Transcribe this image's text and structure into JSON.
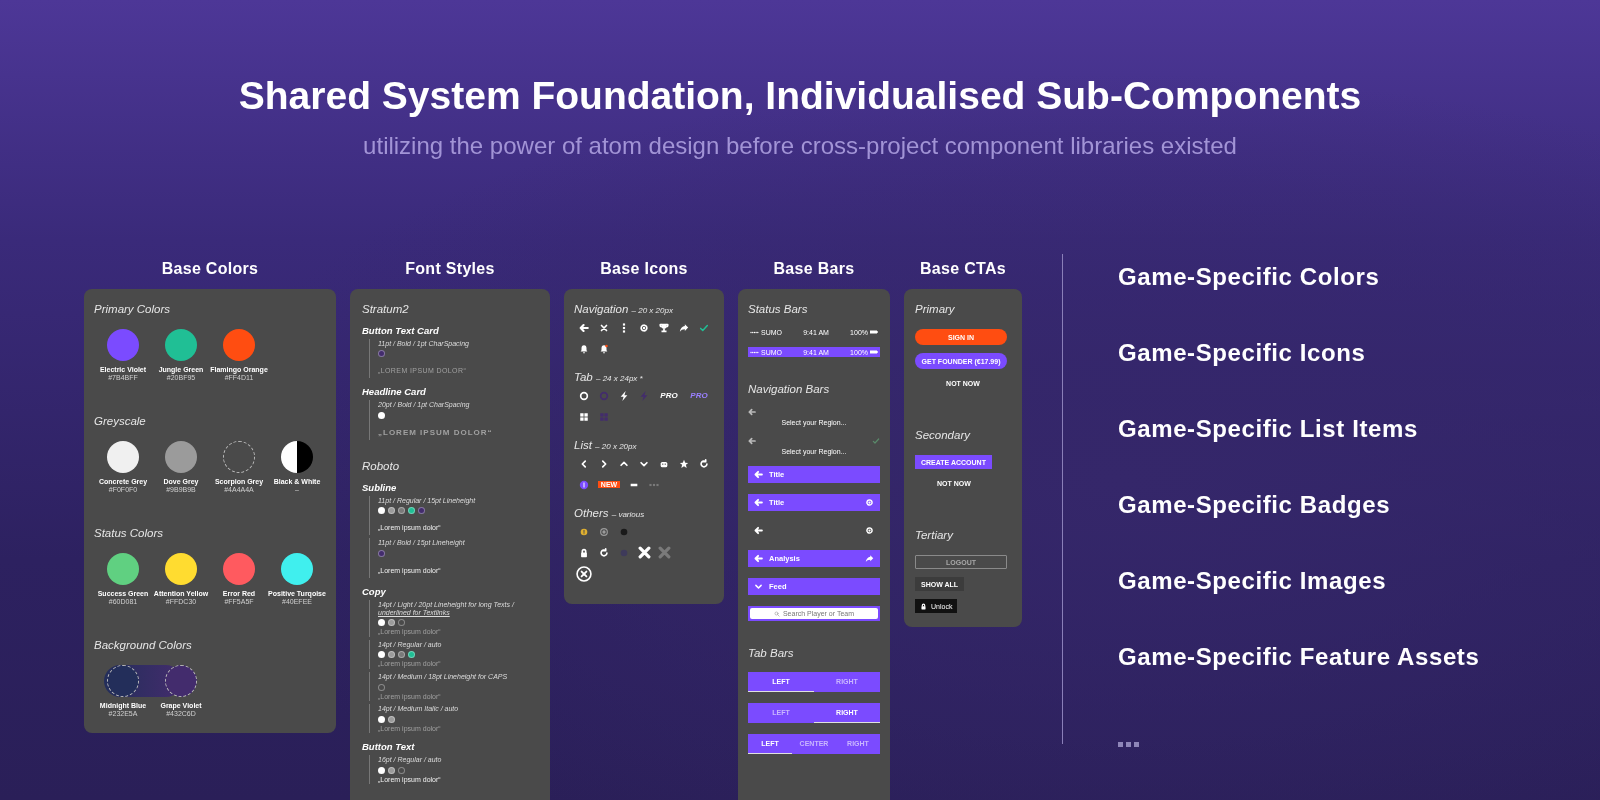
{
  "title": "Shared System Foundation, Individualised Sub-Components",
  "subtitle": "utilizing the power of atom design before cross-project component libraries existed",
  "base_colors": {
    "heading": "Base Colors",
    "groups": [
      {
        "title": "Primary Colors",
        "joined": false,
        "swatches": [
          {
            "name": "Electric Violet",
            "hex": "#7B4BFF",
            "color": "#7b4bff",
            "kind": "solid"
          },
          {
            "name": "Jungle Green",
            "hex": "#20BF95",
            "color": "#20bf95",
            "kind": "solid"
          },
          {
            "name": "Flamingo Orange",
            "hex": "#FF4D11",
            "color": "#ff4d11",
            "kind": "solid"
          }
        ]
      },
      {
        "title": "Greyscale",
        "joined": false,
        "swatches": [
          {
            "name": "Concrete Grey",
            "hex": "#F0F0F0",
            "color": "#f0f0f0",
            "kind": "solid"
          },
          {
            "name": "Dove Grey",
            "hex": "#9B9B9B",
            "color": "#9b9b9b",
            "kind": "solid"
          },
          {
            "name": "Scorpion Grey",
            "hex": "#4A4A4A",
            "color": "#4a4a4a",
            "kind": "dashed"
          },
          {
            "name": "Black & White",
            "hex": "–",
            "color": "#ffffff",
            "kind": "split"
          }
        ]
      },
      {
        "title": "Status Colors",
        "joined": false,
        "swatches": [
          {
            "name": "Success Green",
            "hex": "#60D081",
            "color": "#60d081",
            "kind": "solid"
          },
          {
            "name": "Attention Yellow",
            "hex": "#FFDC30",
            "color": "#ffdc30",
            "kind": "solid"
          },
          {
            "name": "Error Red",
            "hex": "#FF5A5F",
            "color": "#ff5a5f",
            "kind": "solid"
          },
          {
            "name": "Positive Turqoise",
            "hex": "#40EFEE",
            "color": "#40efee",
            "kind": "solid"
          }
        ]
      },
      {
        "title": "Background Colors",
        "joined": true,
        "swatches": [
          {
            "name": "Midnight Blue",
            "hex": "#232E5A",
            "color": "#232e5a",
            "kind": "dashed"
          },
          {
            "name": "Grape Violet",
            "hex": "#432C6D",
            "color": "#432c6d",
            "kind": "dashed"
          }
        ]
      }
    ]
  },
  "font_styles": {
    "heading": "Font Styles",
    "families": [
      {
        "family": "Stratum2",
        "styles": [
          {
            "name": "Button Text Card",
            "specs": [
              {
                "spec": "11pt / Bold / 1pt CharSpacing",
                "dots": [
                  {
                    "color": "#432c6d"
                  }
                ],
                "sample": "„LOREM IPSUM DOLOR“",
                "kind": "caps",
                "bright": false
              }
            ]
          },
          {
            "name": "Headline Card",
            "specs": [
              {
                "spec": "20pt / Bold / 1pt CharSpacing",
                "dots": [
                  {
                    "color": "#ffffff"
                  }
                ],
                "sample": "„LOREM IPSUM DOLOR“",
                "kind": "headline",
                "bright": false
              }
            ]
          }
        ]
      },
      {
        "family": "Roboto",
        "styles": [
          {
            "name": "Subline",
            "specs": [
              {
                "spec": "11pt / Regular / 15pt Lineheight",
                "dots": [
                  {
                    "color": "#ffffff"
                  },
                  {
                    "color": "#9b9b9b"
                  },
                  {
                    "color": "#7a7a7a"
                  },
                  {
                    "color": "#20bf95"
                  },
                  {
                    "color": "#432c6d"
                  }
                ],
                "sample": "„Lorem ipsum dolor“",
                "kind": "small",
                "bright": true
              },
              {
                "spec": "11pt / Bold / 15pt Lineheight",
                "dots": [
                  {
                    "color": "#432c6d"
                  }
                ],
                "sample": "„Lorem ipsum dolor“",
                "kind": "small",
                "bright": true
              }
            ]
          },
          {
            "name": "Copy",
            "specs": [
              {
                "spec": "14pt / Light / 20pt Lineheight for long Texts / ",
                "link": "underlined for Textlinks",
                "dots": [
                  {
                    "color": "#ffffff"
                  },
                  {
                    "color": "#9b9b9b"
                  },
                  {
                    "color": "#4a4a4a"
                  }
                ],
                "sample": "„Lorem ipsum dolor“",
                "kind": "plain",
                "bright": false
              },
              {
                "spec": "14pt / Regular / auto",
                "dots": [
                  {
                    "color": "#ffffff"
                  },
                  {
                    "color": "#9b9b9b"
                  },
                  {
                    "color": "#7a7a7a"
                  },
                  {
                    "color": "#20bf95"
                  }
                ],
                "sample": "„Lorem ipsum dolor“",
                "kind": "plain",
                "bright": false
              },
              {
                "spec": "14pt / Medium / 18pt Lineheight for CAPS",
                "dots": [
                  {
                    "color": "#4a4a4a"
                  }
                ],
                "sample": "„Lorem ipsum dolor“",
                "kind": "plain",
                "bright": false
              },
              {
                "spec": "14pt / Medium Italic / auto",
                "dots": [
                  {
                    "color": "#ffffff"
                  },
                  {
                    "color": "#9b9b9b"
                  }
                ],
                "sample": "„Lorem ipsum dolor“",
                "kind": "plain",
                "bright": false
              }
            ]
          },
          {
            "name": "Button Text",
            "specs": [
              {
                "spec": "16pt / Regular / auto",
                "dots": [
                  {
                    "color": "#ffffff"
                  },
                  {
                    "color": "#9b9b9b"
                  },
                  {
                    "color": "#4a4a4a"
                  }
                ],
                "sample": "„Lorem ipsum dolor“",
                "kind": "plain",
                "bright": true
              }
            ]
          }
        ]
      }
    ]
  },
  "base_icons": {
    "heading": "Base Icons",
    "sections": [
      {
        "title": "Navigation",
        "size": "– 20 x 20px",
        "rows": [
          [
            {
              "kind": "back",
              "color": "#ffffff"
            },
            {
              "kind": "close",
              "color": "#ffffff"
            },
            {
              "kind": "more",
              "color": "#ffffff"
            },
            {
              "kind": "gear",
              "color": "#ffffff"
            },
            {
              "kind": "trophy",
              "color": "#ffffff"
            },
            {
              "kind": "share",
              "color": "#ffffff"
            },
            {
              "kind": "check",
              "color": "#20bf95"
            }
          ],
          [
            {
              "kind": "bell",
              "color": "#ffffff"
            },
            {
              "kind": "bell-dot",
              "color": "#ffffff"
            }
          ]
        ]
      },
      {
        "title": "Tab",
        "size": "– 24 x 24px *",
        "rows": [
          [
            {
              "kind": "ring",
              "color": "#ffffff"
            },
            {
              "kind": "ring",
              "color": "#432c6d"
            },
            {
              "kind": "bolt",
              "color": "#ffffff"
            },
            {
              "kind": "bolt",
              "color": "#432c6d"
            },
            {
              "kind": "text",
              "text": "PRO",
              "color": "#ffffff"
            },
            {
              "kind": "text",
              "text": "PRO",
              "color": "#9a80ff"
            }
          ],
          [
            {
              "kind": "grid",
              "color": "#ffffff"
            },
            {
              "kind": "grid",
              "color": "#432c6d"
            }
          ]
        ]
      },
      {
        "title": "List",
        "size": "– 20 x 20px",
        "rows": [
          [
            {
              "kind": "chevron-left",
              "color": "#ffffff"
            },
            {
              "kind": "chevron-right",
              "color": "#ffffff"
            },
            {
              "kind": "chevron-up",
              "color": "#ffffff"
            },
            {
              "kind": "chevron-down",
              "color": "#ffffff"
            },
            {
              "kind": "robot",
              "color": "#ffffff"
            },
            {
              "kind": "star",
              "color": "#ffffff"
            },
            {
              "kind": "refresh",
              "color": "#ffffff"
            }
          ],
          [
            {
              "kind": "info",
              "color": "#7b4bff"
            },
            {
              "kind": "badge",
              "text": "NEW",
              "color": "#ff4d11"
            },
            {
              "kind": "minus",
              "color": "#ffffff"
            },
            {
              "kind": "dots",
              "color": "#7a7a7a"
            }
          ]
        ]
      },
      {
        "title": "Others",
        "size": "– various",
        "rows": [
          [
            {
              "kind": "alert",
              "color": "#e0b030"
            },
            {
              "kind": "clock",
              "color": "#9b9b9b"
            },
            {
              "kind": "disc",
              "color": "#1a1a1a"
            }
          ],
          [
            {
              "kind": "lock",
              "color": "#ffffff"
            },
            {
              "kind": "refresh",
              "color": "#ffffff"
            },
            {
              "kind": "disc",
              "color": "#3e3a5a"
            },
            {
              "kind": "big-x",
              "color": "#ffffff"
            },
            {
              "kind": "big-x",
              "color": "#7a7a7a"
            }
          ],
          [
            {
              "kind": "circle-x",
              "color": "#ffffff"
            }
          ]
        ]
      }
    ]
  },
  "base_bars": {
    "heading": "Base Bars",
    "sections": [
      {
        "title": "Status Bars",
        "items": [
          {
            "kind": "status",
            "filled": false,
            "carrier": "SUMO",
            "time": "9:41 AM",
            "battery": "100%"
          },
          {
            "kind": "status",
            "filled": true,
            "carrier": "SUMO",
            "time": "9:41 AM",
            "battery": "100%"
          }
        ]
      },
      {
        "title": "Navigation Bars",
        "items": [
          {
            "kind": "plain",
            "title": "Select your Region...",
            "check": false
          },
          {
            "kind": "plain",
            "title": "Select your Region...",
            "check": true
          },
          {
            "kind": "filled",
            "collapsible": false,
            "title": "Title",
            "settings": false,
            "share": false
          },
          {
            "kind": "filled",
            "collapsible": false,
            "title": "Title",
            "settings": true,
            "share": false
          },
          {
            "kind": "clear",
            "collapsible": false,
            "settings": true,
            "share": false
          },
          {
            "kind": "filled",
            "collapsible": false,
            "title": "Analysis",
            "settings": false,
            "share": true
          },
          {
            "kind": "filled",
            "collapsible": true,
            "title": "Feed",
            "settings": false,
            "share": false
          },
          {
            "kind": "search",
            "placeholder": "Search Player or Team"
          }
        ]
      },
      {
        "title": "Tab Bars",
        "items": [
          {
            "kind": "tabs",
            "tabs": [
              {
                "label": "LEFT",
                "selected": true
              },
              {
                "label": "RIGHT",
                "selected": false
              }
            ]
          },
          {
            "kind": "tabs",
            "tabs": [
              {
                "label": "LEFT",
                "selected": false
              },
              {
                "label": "RIGHT",
                "selected": true
              }
            ]
          },
          {
            "kind": "tabs",
            "tabs": [
              {
                "label": "LEFT",
                "selected": true
              },
              {
                "label": "CENTER",
                "selected": false
              },
              {
                "label": "RIGHT",
                "selected": false
              }
            ]
          }
        ]
      }
    ]
  },
  "base_ctas": {
    "heading": "Base CTAs",
    "sections": [
      {
        "title": "Primary",
        "buttons": [
          {
            "kind": "pill-orange",
            "label": "SIGN IN"
          },
          {
            "kind": "pill-violet",
            "label": "GET FOUNDER (€17.99)"
          },
          {
            "kind": "text",
            "label": "NOT NOW"
          }
        ]
      },
      {
        "title": "Secondary",
        "buttons": [
          {
            "kind": "rect-violet",
            "label": "CREATE ACCOUNT"
          },
          {
            "kind": "text",
            "label": "NOT NOW"
          }
        ]
      },
      {
        "title": "Tertiary",
        "buttons": [
          {
            "kind": "outline",
            "label": "LOGOUT"
          },
          {
            "kind": "dark",
            "label": "SHOW ALL"
          },
          {
            "kind": "lock",
            "label": "Unlock"
          }
        ]
      }
    ]
  },
  "game_specific": [
    "Game-Specific Colors",
    "Game-Specific Icons",
    "Game-Specific List Items",
    "Game-Specific Badges",
    "Game-Specific Images",
    "Game-Specific Feature Assets"
  ]
}
